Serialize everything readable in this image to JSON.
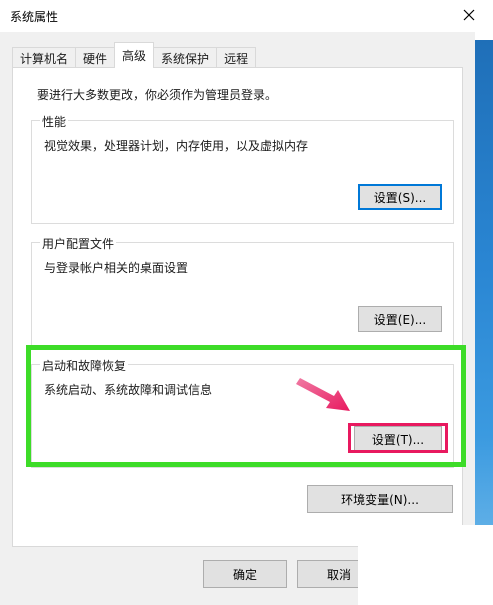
{
  "window": {
    "title": "系统属性"
  },
  "tabs": [
    {
      "label": "计算机名"
    },
    {
      "label": "硬件"
    },
    {
      "label": "高级"
    },
    {
      "label": "系统保护"
    },
    {
      "label": "远程"
    }
  ],
  "admin_note": "要进行大多数更改，你必须作为管理员登录。",
  "performance": {
    "title": "性能",
    "description": "视觉效果，处理器计划，内存使用，以及虚拟内存",
    "button": "设置(S)..."
  },
  "user_profiles": {
    "title": "用户配置文件",
    "description": "与登录帐户相关的桌面设置",
    "button": "设置(E)..."
  },
  "startup_recovery": {
    "title": "启动和故障恢复",
    "description": "系统启动、系统故障和调试信息",
    "button": "设置(T)..."
  },
  "env_vars_button": "环境变量(N)...",
  "footer": {
    "ok": "确定",
    "cancel": "取消"
  },
  "colors": {
    "highlight_green": "#3ddc28",
    "highlight_pink": "#e8195f",
    "focus_blue": "#0078d7"
  }
}
